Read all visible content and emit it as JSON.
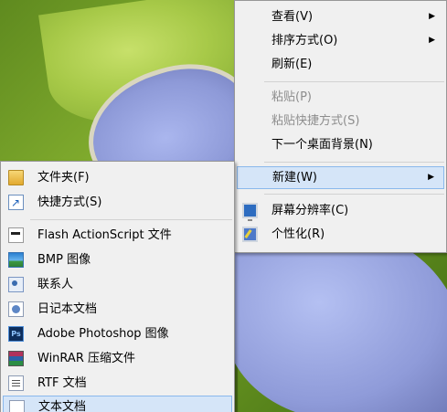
{
  "context_menu": {
    "items": [
      {
        "label": "查看(V)",
        "has_submenu": true,
        "enabled": true
      },
      {
        "label": "排序方式(O)",
        "has_submenu": true,
        "enabled": true
      },
      {
        "label": "刷新(E)",
        "has_submenu": false,
        "enabled": true
      },
      {
        "label": "粘贴(P)",
        "has_submenu": false,
        "enabled": false
      },
      {
        "label": "粘贴快捷方式(S)",
        "has_submenu": false,
        "enabled": false
      },
      {
        "label": "下一个桌面背景(N)",
        "has_submenu": false,
        "enabled": true
      },
      {
        "label": "新建(W)",
        "has_submenu": true,
        "enabled": true,
        "highlighted": true
      },
      {
        "label": "屏幕分辨率(C)",
        "has_submenu": false,
        "enabled": true,
        "icon": "screen-resolution-icon"
      },
      {
        "label": "个性化(R)",
        "has_submenu": false,
        "enabled": true,
        "icon": "personalize-icon"
      }
    ],
    "submenu_arrow": "▶"
  },
  "new_submenu": {
    "items": [
      {
        "label": "文件夹(F)",
        "icon": "folder-icon"
      },
      {
        "label": "快捷方式(S)",
        "icon": "shortcut-icon"
      },
      {
        "label": "Flash ActionScript 文件",
        "icon": "flash-actionscript-icon"
      },
      {
        "label": "BMP 图像",
        "icon": "bmp-image-icon"
      },
      {
        "label": "联系人",
        "icon": "contact-icon"
      },
      {
        "label": "日记本文档",
        "icon": "journal-document-icon"
      },
      {
        "label": "Adobe Photoshop 图像",
        "icon": "photoshop-icon",
        "icon_text": "Ps"
      },
      {
        "label": "WinRAR 压缩文件",
        "icon": "winrar-icon"
      },
      {
        "label": "RTF 文档",
        "icon": "rtf-document-icon"
      },
      {
        "label": "文本文档",
        "icon": "text-document-icon",
        "highlighted": true
      }
    ]
  },
  "colors": {
    "menu_background": "#f0f0f0",
    "highlight_background": "#d5e5f8",
    "highlight_border": "#8ab8ec",
    "disabled_text": "#8d8d8d"
  }
}
